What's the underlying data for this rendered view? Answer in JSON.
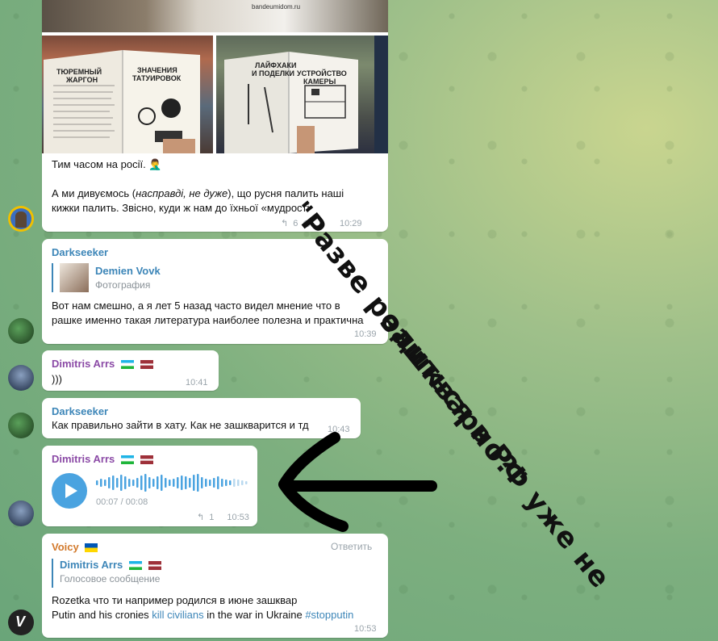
{
  "messages": {
    "m1": {
      "line1": "Тим часом на росії. 🤦‍♂️",
      "line2_a": "А ми дивуємось (",
      "line2_em": "насправді, не дуже",
      "line2_b": "), що русня палить наші",
      "line3": "кижки палить. Звісно, куди ж нам до їхньої «мудрості»",
      "reactions": "6",
      "time": "10:29",
      "banner": "bandeumidom.ru"
    },
    "m2": {
      "sender": "Darkseeker",
      "reply_name": "Demien Vovk",
      "reply_sub": "Фотография",
      "line1": "Вот нам смешно, а я лет 5 назад часто видел мнение что в",
      "line2": "рашке именно такая литература наиболее полезна и практична",
      "time": "10:39"
    },
    "m3": {
      "sender": "Dimitris Arrs",
      "text": ")))",
      "time": "10:41"
    },
    "m4": {
      "sender": "Darkseeker",
      "text": "Как правильно зайти в хату. Как не зашкварится и тд",
      "time": "10:43"
    },
    "m5": {
      "sender": "Dimitris Arrs",
      "duration": "00:07 / 00:08",
      "progress": 0.875,
      "replies": "1",
      "time": "10:53"
    },
    "m6": {
      "sender": "Voicy",
      "reply_action": "Ответить",
      "reply_name": "Dimitris Arrs",
      "reply_sub": "Голосовое сообщение",
      "line1": "Rozetka что ти например родился в июне зашквар",
      "line2_a": "Putin and his cronies ",
      "line2_link1": "kill civilians",
      "line2_b": " in the war in Ukraine ",
      "line2_link2": "#stopputin",
      "time": "10:53"
    }
  },
  "book_left": {
    "title1": "ТЮРЕМНЫЙ",
    "title2": "ЖАРГОН",
    "title3": "ЗНАЧЕНИЯ",
    "title4": "ТАТУИРОВОК"
  },
  "book_right": {
    "title1": "ЛАЙФХАКИ",
    "title2": "И ПОДЕЛКИ",
    "title3": "УСТРОЙСТВО",
    "title4": "КАМЕРЫ"
  },
  "overlay": {
    "line1": "\"Разве родиться в РФ уже не",
    "line2": "зашкварно?\""
  },
  "colors": {
    "accent": "#3d86b8",
    "purple_sender": "#8b4aa6",
    "orange_sender": "#d2792b",
    "play_button": "#4aa3e0"
  }
}
